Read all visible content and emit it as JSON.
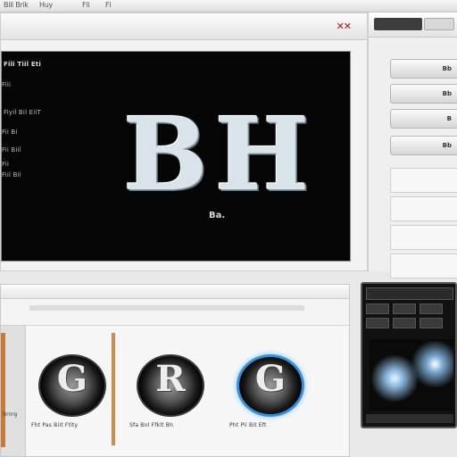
{
  "topbar": {
    "menus": [
      "Bill Brik",
      "Huy",
      "Fli",
      "Fl"
    ]
  },
  "main_window": {
    "close_label": "✕✕"
  },
  "viewer": {
    "lines": [
      "Fili Tiil Eti",
      "Fili",
      "Fiyil Bil EiiT",
      "Fii Bi",
      "Fii Biil",
      "Fii",
      "Fiil Bil"
    ],
    "logo": "BH",
    "tag": "Ba."
  },
  "right_panel": {
    "buttons": [
      "Bb",
      "Bb",
      "B",
      "Bb"
    ]
  },
  "bottom_panel": {
    "sidebar_label": "Brnrg",
    "thumbnails": [
      {
        "glyph": "G",
        "label": "Fht Pas Biit Ftlty"
      },
      {
        "glyph": "R",
        "label": "Sfa Bnl Ffklt Bh"
      },
      {
        "glyph": "G",
        "label": "Pht Pii Bit Eft"
      }
    ]
  }
}
